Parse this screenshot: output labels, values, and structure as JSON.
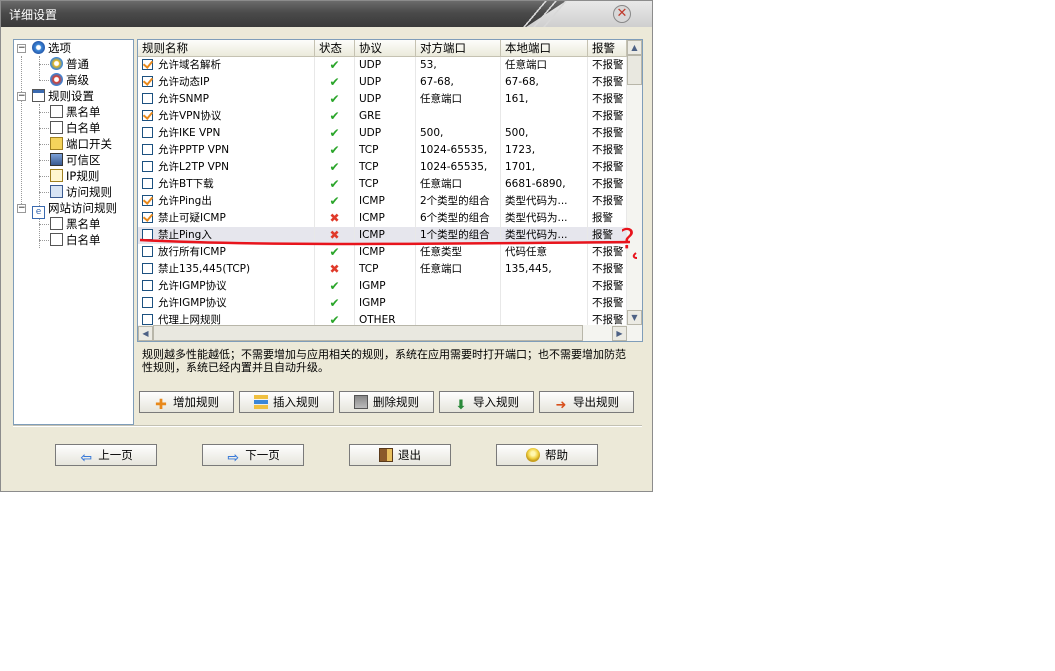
{
  "window": {
    "title": "详细设置"
  },
  "tree": {
    "nodes": [
      {
        "label": "选项"
      },
      {
        "label": "普通"
      },
      {
        "label": "高级"
      },
      {
        "label": "规则设置"
      },
      {
        "label": "黑名单"
      },
      {
        "label": "白名单"
      },
      {
        "label": "端口开关"
      },
      {
        "label": "可信区"
      },
      {
        "label": "IP规则"
      },
      {
        "label": "访问规则"
      },
      {
        "label": "网站访问规则"
      },
      {
        "label": "黑名单"
      },
      {
        "label": "白名单"
      }
    ]
  },
  "grid": {
    "columns": [
      "规则名称",
      "状态",
      "协议",
      "对方端口",
      "本地端口",
      "报警"
    ],
    "rows": [
      {
        "checked": true,
        "name": "允许域名解析",
        "status": "ok",
        "protocol": "UDP",
        "remote": "53,",
        "local": "任意端口",
        "alarm": "不报警"
      },
      {
        "checked": true,
        "name": "允许动态IP",
        "status": "ok",
        "protocol": "UDP",
        "remote": "67-68,",
        "local": "67-68,",
        "alarm": "不报警"
      },
      {
        "checked": false,
        "name": "允许SNMP",
        "status": "ok",
        "protocol": "UDP",
        "remote": "任意端口",
        "local": "161,",
        "alarm": "不报警"
      },
      {
        "checked": true,
        "name": "允许VPN协议",
        "status": "ok",
        "protocol": "GRE",
        "remote": "",
        "local": "",
        "alarm": "不报警"
      },
      {
        "checked": false,
        "name": "允许IKE VPN",
        "status": "ok",
        "protocol": "UDP",
        "remote": "500,",
        "local": "500,",
        "alarm": "不报警"
      },
      {
        "checked": false,
        "name": "允许PPTP VPN",
        "status": "ok",
        "protocol": "TCP",
        "remote": "1024-65535,",
        "local": "1723,",
        "alarm": "不报警"
      },
      {
        "checked": false,
        "name": "允许L2TP VPN",
        "status": "ok",
        "protocol": "TCP",
        "remote": "1024-65535,",
        "local": "1701,",
        "alarm": "不报警"
      },
      {
        "checked": false,
        "name": "允许BT下载",
        "status": "ok",
        "protocol": "TCP",
        "remote": "任意端口",
        "local": "6681-6890,",
        "alarm": "不报警"
      },
      {
        "checked": true,
        "name": "允许Ping出",
        "status": "ok",
        "protocol": "ICMP",
        "remote": "2个类型的组合",
        "local": "类型代码为...",
        "alarm": "不报警"
      },
      {
        "checked": true,
        "name": "禁止可疑ICMP",
        "status": "no",
        "protocol": "ICMP",
        "remote": "6个类型的组合",
        "local": "类型代码为...",
        "alarm": "报警"
      },
      {
        "checked": false,
        "name": "禁止Ping入",
        "status": "no",
        "protocol": "ICMP",
        "remote": "1个类型的组合",
        "local": "类型代码为...",
        "alarm": "报警"
      },
      {
        "checked": false,
        "name": "放行所有ICMP",
        "status": "ok",
        "protocol": "ICMP",
        "remote": "任意类型",
        "local": "代码任意",
        "alarm": "不报警"
      },
      {
        "checked": false,
        "name": "禁止135,445(TCP)",
        "status": "no",
        "protocol": "TCP",
        "remote": "任意端口",
        "local": "135,445,",
        "alarm": "不报警"
      },
      {
        "checked": false,
        "name": "允许IGMP协议",
        "status": "ok",
        "protocol": "IGMP",
        "remote": "",
        "local": "",
        "alarm": "不报警"
      },
      {
        "checked": false,
        "name": "允许IGMP协议",
        "status": "ok",
        "protocol": "IGMP",
        "remote": "",
        "local": "",
        "alarm": "不报警"
      },
      {
        "checked": false,
        "name": "代理上网规则",
        "status": "ok",
        "protocol": "OTHER",
        "remote": "",
        "local": "",
        "alarm": "不报警"
      }
    ]
  },
  "description": "规则越多性能越低；不需要增加与应用相关的规则，系统在应用需要时打开端口；也不需要增加防范性规则，系统已经内置并且自动升级。",
  "actions": {
    "add": "增加规则",
    "insert": "插入规则",
    "delete": "删除规则",
    "import": "导入规则",
    "export": "导出规则"
  },
  "nav": {
    "prev": "上一页",
    "next": "下一页",
    "exit": "退出",
    "help": "帮助"
  },
  "annotation": {
    "mark": "?",
    "color": "#e8141c"
  },
  "colors": {
    "ok": "#2aa52a",
    "no": "#e03a2a",
    "check": "#e8891c"
  }
}
